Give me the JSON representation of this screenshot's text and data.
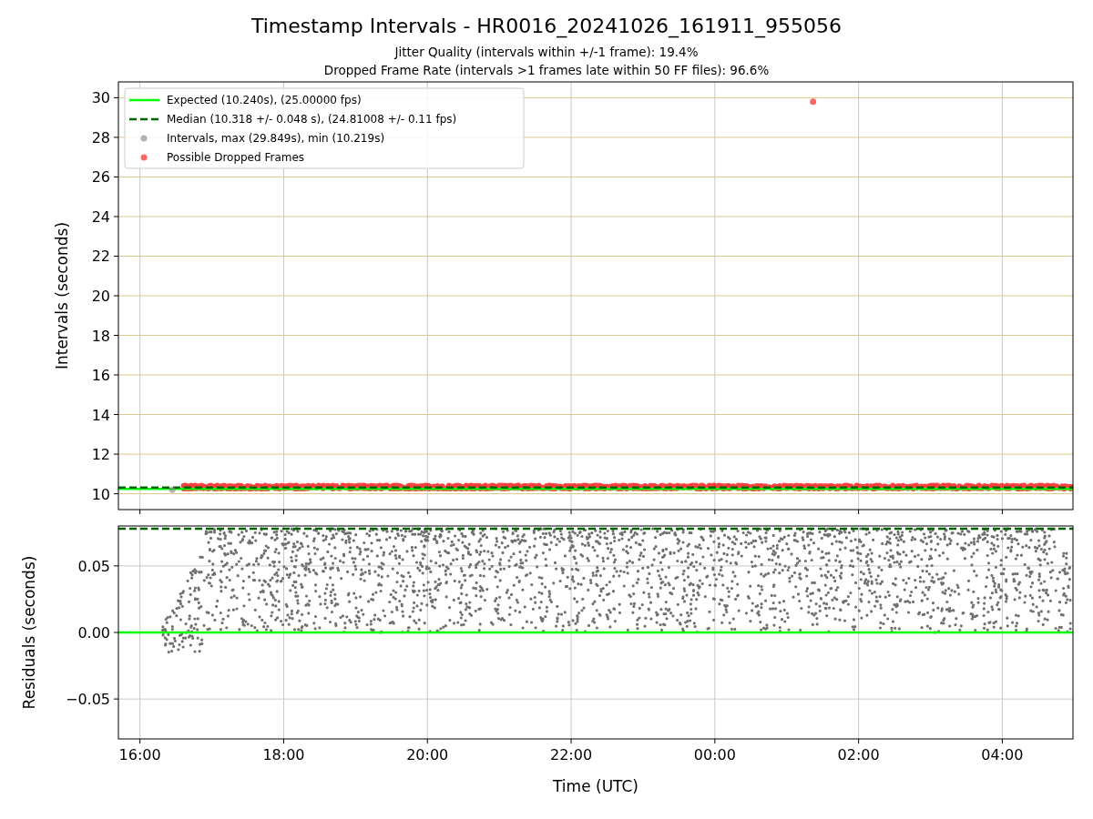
{
  "figure": {
    "title": "Timestamp Intervals - HR0016_20241026_161911_955056",
    "subtitles": [
      "Jitter Quality (intervals within +/-1 frame): 19.4%",
      "Dropped Frame Rate (intervals >1 frames late within 50 FF files): 96.6%"
    ]
  },
  "intervals_plot": {
    "chart_data": {
      "type": "scatter",
      "ylabel": "Intervals (seconds)",
      "grid": true,
      "legend": "upper left",
      "xlim": [
        "2024-10-26T15:42",
        "2024-10-27T04:59"
      ],
      "ylim": [
        9.2,
        30.8
      ],
      "yticks": [
        {
          "value": 10,
          "label": "10"
        },
        {
          "value": 12,
          "label": "12"
        },
        {
          "value": 14,
          "label": "14"
        },
        {
          "value": 16,
          "label": "16"
        },
        {
          "value": 18,
          "label": "18"
        },
        {
          "value": 20,
          "label": "20"
        },
        {
          "value": 22,
          "label": "22"
        },
        {
          "value": 24,
          "label": "24"
        },
        {
          "value": 26,
          "label": "26"
        },
        {
          "value": 28,
          "label": "28"
        },
        {
          "value": 30,
          "label": "30"
        }
      ],
      "series": [
        {
          "name": "Expected (10.240s), (25.00000 fps)",
          "color": "#00ff00",
          "type": "line",
          "line_style": "solid",
          "x": [
            "2024-10-26T15:42",
            "2024-10-27T04:59"
          ],
          "values": [
            10.24,
            10.24
          ]
        },
        {
          "name": "Median (10.318 +/- 0.048 s), (24.81008 +/- 0.11 fps)",
          "color": "#006400",
          "type": "line",
          "line_style": "dashed",
          "x": [
            "2024-10-26T15:42",
            "2024-10-27T04:59"
          ],
          "values": [
            10.32,
            10.32
          ]
        },
        {
          "name": "Intervals, max (29.849s), min (10.219s)",
          "color": "#808080",
          "type": "scatter",
          "x": [
            "2024-10-26T16:27"
          ],
          "values": [
            10.2
          ]
        },
        {
          "name": "Possible Dropped Frames",
          "color": "#ff0000",
          "type": "scatter",
          "x": [
            "2024-10-27T01:22"
          ],
          "values": [
            29.8
          ]
        }
      ]
    }
  },
  "residuals_plot": {
    "chart_data": {
      "type": "scatter",
      "xlabel": "Time (UTC)",
      "ylabel": "Residuals (seconds)",
      "grid": true,
      "xlim": [
        "2024-10-26T15:42",
        "2024-10-27T04:59"
      ],
      "ylim": [
        -0.08,
        0.08
      ],
      "xticks": [
        {
          "value": "2024-10-26T16:00",
          "label": "16:00"
        },
        {
          "value": "2024-10-26T18:00",
          "label": "18:00"
        },
        {
          "value": "2024-10-26T20:00",
          "label": "20:00"
        },
        {
          "value": "2024-10-26T22:00",
          "label": "22:00"
        },
        {
          "value": "2024-10-27T00:00",
          "label": "00:00"
        },
        {
          "value": "2024-10-27T02:00",
          "label": "02:00"
        },
        {
          "value": "2024-10-27T04:00",
          "label": "04:00"
        }
      ],
      "yticks": [
        {
          "value": -0.05,
          "label": "−0.05"
        },
        {
          "value": 0,
          "label": "0.00"
        },
        {
          "value": 0.05,
          "label": "0.05"
        }
      ],
      "series": [
        {
          "color": "#00ff00",
          "type": "line",
          "line_style": "solid",
          "x": [
            "2024-10-26T15:42",
            "2024-10-27T04:59"
          ],
          "values": [
            0,
            0
          ]
        },
        {
          "color": "#006400",
          "type": "line",
          "line_style": "dashed",
          "x": [
            "2024-10-26T15:42",
            "2024-10-27T04:59"
          ],
          "values": [
            0.078,
            0.078
          ]
        }
      ]
    }
  }
}
